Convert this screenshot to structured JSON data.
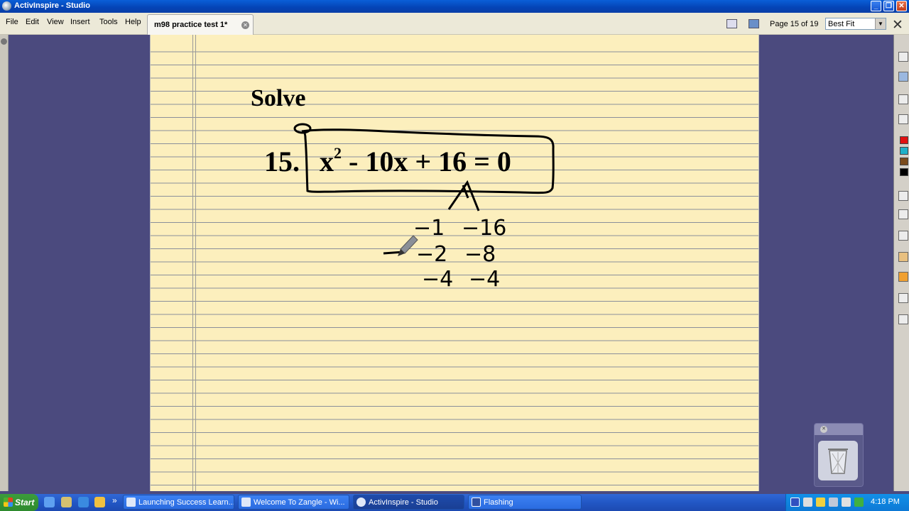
{
  "window": {
    "title": "ActivInspire - Studio",
    "buttons": [
      "_",
      "❐",
      "✕"
    ]
  },
  "menu": [
    "File",
    "Edit",
    "View",
    "Insert",
    "Tools",
    "Help"
  ],
  "tab": {
    "label": "m98 practice test 1*"
  },
  "toolbar": {
    "page_indicator": "Page 15 of 19",
    "zoom": "Best Fit"
  },
  "page": {
    "heading": "Solve",
    "problem_number": "15.",
    "equation": {
      "part1": "x",
      "exponent": "2",
      "part2": " - 10x + 16 = 0"
    },
    "handwriting": [
      {
        "a": "−1",
        "b": "−16"
      },
      {
        "a": "−2",
        "b": "−8"
      },
      {
        "a": "−4",
        "b": "−4"
      }
    ]
  },
  "taskbar": {
    "start": "Start",
    "tasks": [
      {
        "label": "Launching Success Learn...",
        "active": false
      },
      {
        "label": "Welcome To Zangle - Wi...",
        "active": false
      },
      {
        "label": "ActivInspire - Studio",
        "active": true
      },
      {
        "label": "Flashing",
        "active": false
      }
    ],
    "clock": "4:18 PM"
  },
  "colors": {
    "title_bar": "#0443b5",
    "page_paper": "#fcefbd",
    "canvas": "#4b4a7e",
    "taskbar": "#2257c5",
    "swatches": [
      "#e01010",
      "#1fb0c8",
      "#7a4a1a",
      "#000000"
    ]
  }
}
